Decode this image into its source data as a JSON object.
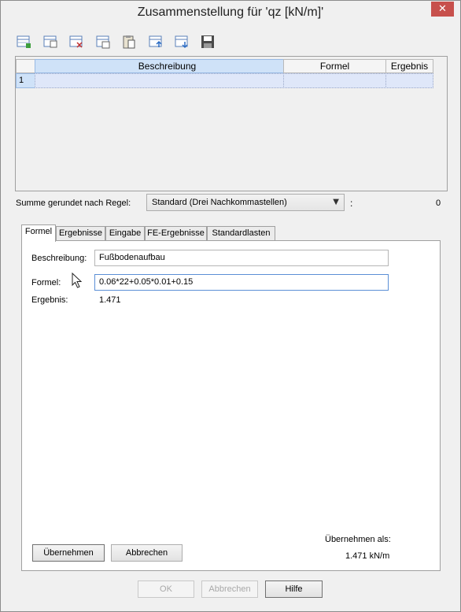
{
  "window": {
    "title": "Zusammenstellung für 'qz [kN/m]'",
    "close_glyph": "✕"
  },
  "toolbar": {
    "buttons": [
      {
        "icon": "add-row-icon"
      },
      {
        "icon": "copy-row-icon"
      },
      {
        "icon": "delete-row-icon"
      },
      {
        "icon": "copy-table-icon"
      },
      {
        "icon": "paste-icon"
      },
      {
        "icon": "import-icon"
      },
      {
        "icon": "export-icon"
      },
      {
        "icon": "save-icon"
      }
    ]
  },
  "grid": {
    "columns": [
      "Beschreibung",
      "Formel",
      "Ergebnis"
    ],
    "rows": [
      {
        "num": "1",
        "beschreibung": "",
        "formel": "",
        "ergebnis": ""
      }
    ]
  },
  "summary": {
    "label": "Summe gerundet nach Regel:",
    "selected": "Standard (Drei Nachkommastellen)",
    "colon": ":",
    "value": "0"
  },
  "tabs": [
    "Formel",
    "Ergebnisse",
    "Eingabe",
    "FE-Ergebnisse",
    "Standardlasten"
  ],
  "formula_tab": {
    "beschreibung_label": "Beschreibung:",
    "beschreibung_value": "Fußbodenaufbau",
    "formel_label": "Formel:",
    "formel_value": "0.06*22+0.05*0.01+0.15",
    "ergebnis_label": "Ergebnis:",
    "ergebnis_value": "1.471",
    "adopt_button": "Übernehmen",
    "cancel_button": "Abbrechen",
    "adopt_as_label": "Übernehmen als:",
    "adopt_as_value": "1.471 kN/m"
  },
  "footer": {
    "ok": "OK",
    "cancel": "Abbrechen",
    "help": "Hilfe"
  }
}
